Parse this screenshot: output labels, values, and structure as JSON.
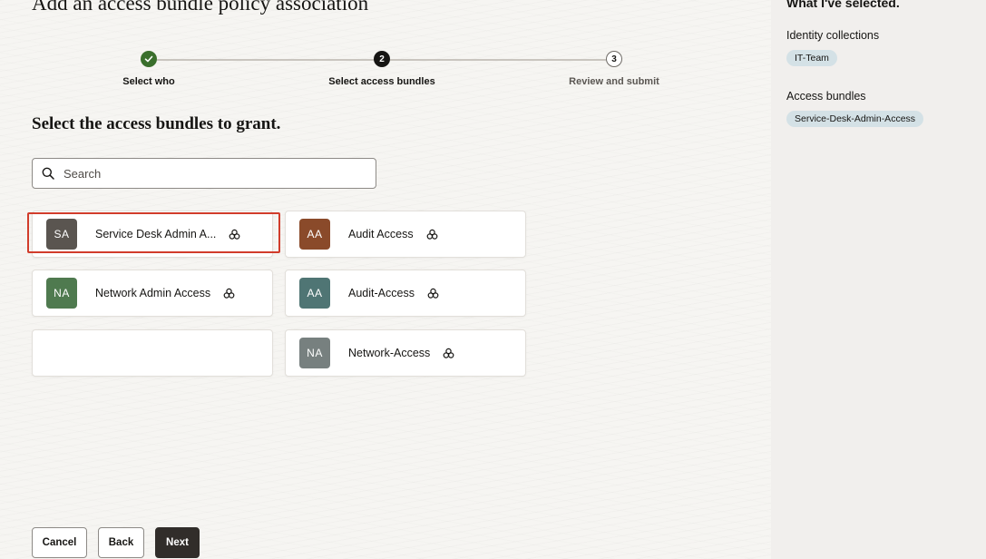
{
  "page": {
    "title": "Add an access bundle policy association"
  },
  "stepper": {
    "steps": [
      {
        "label": "Select who",
        "number": "1",
        "state": "done"
      },
      {
        "label": "Select access bundles",
        "number": "2",
        "state": "current"
      },
      {
        "label": "Review and submit",
        "number": "3",
        "state": "todo"
      }
    ]
  },
  "main": {
    "section_title": "Select the access bundles to grant.",
    "search": {
      "placeholder": "Search",
      "value": ""
    },
    "cards": [
      {
        "initials": "SA",
        "label": "Service Desk Admin A...",
        "color": "#5a5550",
        "selected": true
      },
      {
        "initials": "AA",
        "label": "Audit Access",
        "color": "#8a4a2a"
      },
      {
        "initials": "NA",
        "label": "Network Admin Access",
        "color": "#4f7a4f"
      },
      {
        "initials": "AA",
        "label": "Audit-Access",
        "color": "#4f7574"
      },
      {
        "initials": "NA",
        "label": "Network-Access",
        "color": "#77807f"
      }
    ]
  },
  "footer": {
    "cancel_label": "Cancel",
    "back_label": "Back",
    "next_label": "Next"
  },
  "side_panel": {
    "title": "What I've selected.",
    "identity_label": "Identity collections",
    "identity_chips": [
      "IT-Team"
    ],
    "bundles_label": "Access bundles",
    "bundle_chips": [
      "Service-Desk-Admin-Access"
    ]
  },
  "colors": {
    "accent_dark": "#312d2a",
    "success": "#3a6f2c",
    "highlight": "#d13c2b",
    "chip": "#d4e1e6"
  }
}
